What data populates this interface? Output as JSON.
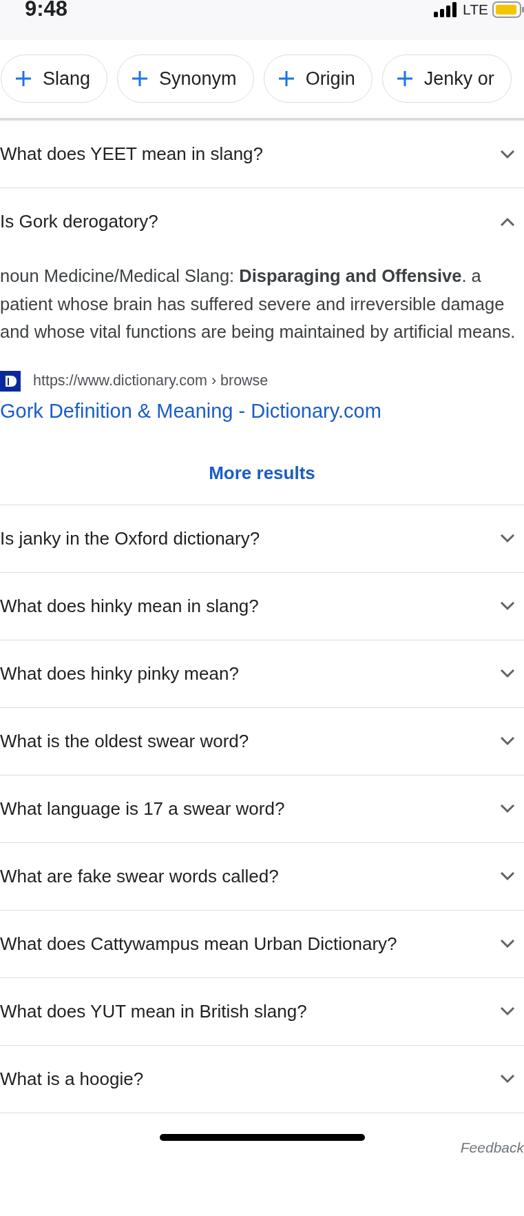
{
  "status_bar": {
    "time": "9:48",
    "network": "LTE"
  },
  "chips": [
    {
      "label": "Slang"
    },
    {
      "label": "Synonym"
    },
    {
      "label": "Origin"
    },
    {
      "label": "Jenky or"
    }
  ],
  "questions": [
    {
      "text": "What does YEET mean in slang?",
      "expanded": false
    },
    {
      "text": "Is Gork derogatory?",
      "expanded": true,
      "answer": {
        "text": "noun Medicine/Medical Slang: **Disparaging and Offensive**. a patient whose brain has suffered severe and irreversible damage and whose vital functions are being maintained by artificial means.",
        "source_url": "https://www.dictionary.com › browse",
        "title": "Gork Definition & Meaning - Dictionary.com",
        "more": "More results"
      }
    },
    {
      "text": "Is janky in the Oxford dictionary?",
      "expanded": false
    },
    {
      "text": "What does hinky mean in slang?",
      "expanded": false
    },
    {
      "text": "What does hinky pinky mean?",
      "expanded": false
    },
    {
      "text": "What is the oldest swear word?",
      "expanded": false
    },
    {
      "text": "What language is 17 a swear word?",
      "expanded": false
    },
    {
      "text": "What are fake swear words called?",
      "expanded": false
    },
    {
      "text": "What does Cattywampus mean Urban Dictionary?",
      "expanded": false
    },
    {
      "text": "What does YUT mean in British slang?",
      "expanded": false
    },
    {
      "text": "What is a hoogie?",
      "expanded": false
    }
  ],
  "feedback": "Feedback"
}
